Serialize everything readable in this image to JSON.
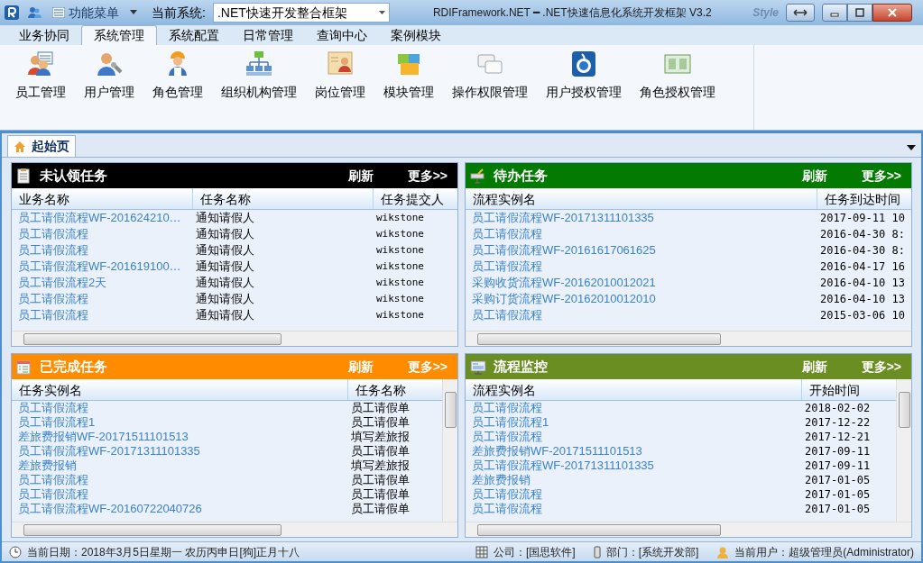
{
  "window": {
    "function_menu": "功能菜单",
    "current_system_label": "当前系统:",
    "current_system": ".NET快速开发整合框架",
    "title": "RDIFramework.NET ━ .NET快速信息化系统开发框架 V3.2",
    "style_label": "Style"
  },
  "menu_tabs": [
    {
      "label": "业务协同",
      "selected": false
    },
    {
      "label": "系统管理",
      "selected": true
    },
    {
      "label": "系统配置",
      "selected": false
    },
    {
      "label": "日常管理",
      "selected": false
    },
    {
      "label": "查询中心",
      "selected": false
    },
    {
      "label": "案例模块",
      "selected": false
    }
  ],
  "ribbon": [
    {
      "label": "员工管理"
    },
    {
      "label": "用户管理"
    },
    {
      "label": "角色管理"
    },
    {
      "label": "组织机构管理"
    },
    {
      "label": "岗位管理"
    },
    {
      "label": "模块管理"
    },
    {
      "label": "操作权限管理"
    },
    {
      "label": "用户授权管理"
    },
    {
      "label": "角色授权管理"
    }
  ],
  "doc_tabs": [
    {
      "label": "起始页",
      "selected": true
    }
  ],
  "panels": [
    {
      "title": "未认领任务",
      "color": "#000000",
      "refresh": "刷新",
      "more": "更多>>",
      "columns": [
        "业务名称",
        "任务名称",
        "任务提交人"
      ],
      "rows": [
        [
          "员工请假流程WF-201624210…",
          "通知请假人",
          "wikstone"
        ],
        [
          "员工请假流程",
          "通知请假人",
          "wikstone"
        ],
        [
          "员工请假流程",
          "通知请假人",
          "wikstone"
        ],
        [
          "员工请假流程WF-201619100…",
          "通知请假人",
          "wikstone"
        ],
        [
          "员工请假流程2天",
          "通知请假人",
          "wikstone"
        ],
        [
          "员工请假流程",
          "通知请假人",
          "wikstone"
        ],
        [
          "员工请假流程",
          "通知请假人",
          "wikstone"
        ]
      ]
    },
    {
      "title": "待办任务",
      "color": "#037b03",
      "refresh": "刷新",
      "more": "更多>>",
      "columns": [
        "流程实例名",
        "任务到达时间"
      ],
      "rows": [
        [
          "员工请假流程WF-20171311101335",
          "2017-09-11 10"
        ],
        [
          "员工请假流程",
          "2016-04-30 8:"
        ],
        [
          "员工请假流程WF-20161617061625",
          "2016-04-30 8:"
        ],
        [
          "员工请假流程",
          "2016-04-17 16"
        ],
        [
          "采购收货流程WF-20162010012021",
          "2016-04-10 13"
        ],
        [
          "采购订货流程WF-20162010012010",
          "2016-04-10 13"
        ],
        [
          "员工请假流程",
          "2015-03-06 10"
        ]
      ]
    },
    {
      "title": "已完成任务",
      "color": "#ff8c00",
      "refresh": "刷新",
      "more": "更多>>",
      "columns": [
        "任务实例名",
        "任务名称"
      ],
      "rows": [
        [
          "员工请假流程",
          "员工请假单"
        ],
        [
          "员工请假流程1",
          "员工请假单"
        ],
        [
          "差旅费报销WF-20171511101513",
          "填写差旅报"
        ],
        [
          "员工请假流程WF-20171311101335",
          "员工请假单"
        ],
        [
          "差旅费报销",
          "填写差旅报"
        ],
        [
          "员工请假流程",
          "员工请假单"
        ],
        [
          "员工请假流程",
          "员工请假单"
        ],
        [
          "员工请假流程WF-20160722040726",
          "员工请假单"
        ]
      ]
    },
    {
      "title": "流程监控",
      "color": "#6b8e23",
      "refresh": "刷新",
      "more": "更多>>",
      "columns": [
        "流程实例名",
        "开始时间"
      ],
      "rows": [
        [
          "员工请假流程",
          "2018-02-02"
        ],
        [
          "员工请假流程1",
          "2017-12-22"
        ],
        [
          "员工请假流程",
          "2017-12-21"
        ],
        [
          "差旅费报销WF-20171511101513",
          "2017-09-11"
        ],
        [
          "员工请假流程WF-20171311101335",
          "2017-09-11"
        ],
        [
          "差旅费报销",
          "2017-01-05"
        ],
        [
          "员工请假流程",
          "2017-01-05"
        ],
        [
          "员工请假流程",
          "2017-01-05"
        ]
      ]
    }
  ],
  "status_bar": {
    "date": "当前日期：2018年3月5日星期一 农历丙申日[狗]正月十八",
    "company": "公司：[国思软件]",
    "department": "部门：[系统开发部]",
    "user": "当前用户：超级管理员(Administrator)"
  }
}
